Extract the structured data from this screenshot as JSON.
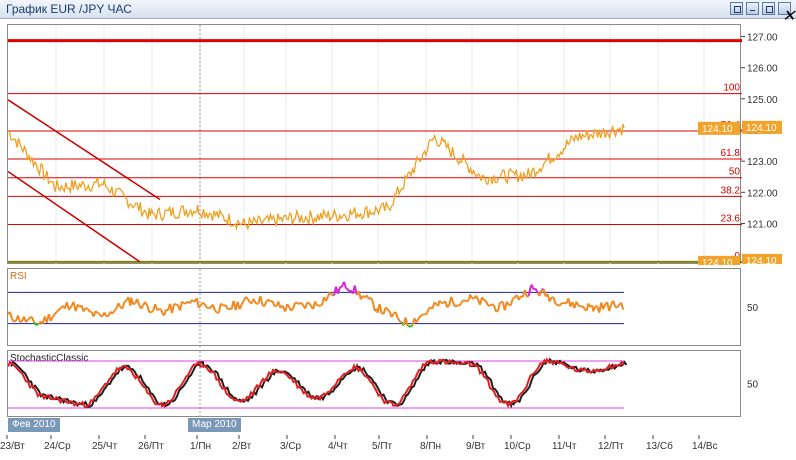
{
  "window": {
    "title": "График EUR /JPY  ЧАС"
  },
  "chart_data": [
    {
      "type": "line",
      "title": "",
      "series": [],
      "x": [
        "23/Вт",
        "24/Ср",
        "25/Чт",
        "26/Пт",
        "1/Пн",
        "2/Вт",
        "3/Ср",
        "4/Чт",
        "5/Пт",
        "8/Пн",
        "9/Вт",
        "10/Ср",
        "11/Чт",
        "12/Пт",
        "13/Сб",
        "14/Вс"
      ],
      "close": [
        124.0,
        122.2,
        122.3,
        121.3,
        121.5,
        121.0,
        121.2,
        121.3,
        121.5,
        123.8,
        122.5,
        122.6,
        123.8,
        124.1
      ],
      "ylim": [
        119.7,
        127.4
      ],
      "y_ticks": [
        "127.00",
        "126.00",
        "125.00",
        "124.00",
        "123.00",
        "122.00",
        "121.00"
      ],
      "current_price": "124.10",
      "fib_levels": [
        {
          "label": "100",
          "value": 125.2
        },
        {
          "label": "76.4",
          "value": 124.0
        },
        {
          "label": "61.8",
          "value": 123.1
        },
        {
          "label": "50",
          "value": 122.5
        },
        {
          "label": "38.2",
          "value": 121.9
        },
        {
          "label": "23.6",
          "value": 121.0
        },
        {
          "label": "0",
          "value": 119.8
        }
      ],
      "colors": {
        "price": "#f0a020",
        "fib": "#dd0000",
        "top_line": "#e00000",
        "bottom_line": "#808000",
        "channel": "#cc0000",
        "tag": "#f2a32b"
      }
    },
    {
      "type": "line",
      "title": "RSI",
      "y_ticks": [
        "50"
      ],
      "values": [
        40,
        30,
        55,
        38,
        60,
        45,
        58,
        48,
        62,
        50,
        55,
        80,
        50,
        30,
        55,
        62,
        50,
        75,
        58,
        50,
        55
      ],
      "colors": {
        "line": "#f08a20",
        "overbought": "#d028d0",
        "oversold": "#30c030",
        "level": "#2020a0"
      }
    },
    {
      "type": "line",
      "title": "StochasticClassic",
      "y_ticks": [
        "50"
      ],
      "values": [
        80,
        30,
        20,
        75,
        20,
        80,
        25,
        70,
        30,
        75,
        20,
        85,
        80,
        20,
        85,
        70,
        80
      ],
      "colors": {
        "main": "#e02020",
        "signal": "#202020",
        "level": "#e040e0"
      }
    }
  ],
  "date_markers": [
    "Фев 2010",
    "Мар 2010"
  ]
}
